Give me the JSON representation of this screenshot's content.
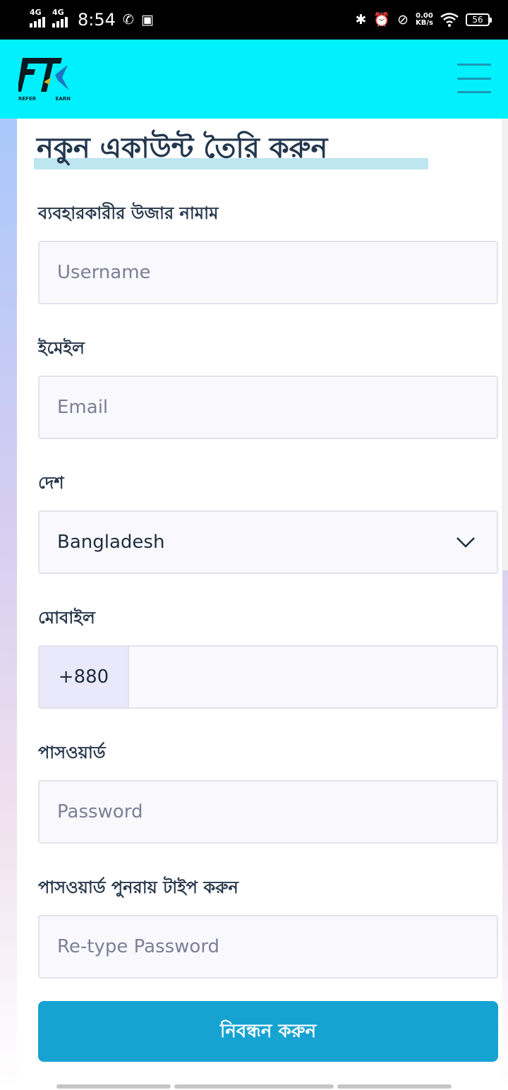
{
  "status_bar": {
    "network_1": "4G",
    "network_2": "4G",
    "time": "8:54",
    "icons": [
      "whatsapp-icon",
      "gallery-icon",
      "bluetooth-icon",
      "alarm-icon",
      "dnd-icon",
      "wifi-icon"
    ],
    "speed_value": "0.00",
    "speed_unit": "KB/s",
    "battery": "56"
  },
  "header": {
    "logo_letters": "FT",
    "logo_word_left": "REFER",
    "logo_word_right": "EARN",
    "brand_color": "#00f0fd"
  },
  "form": {
    "title": "নকুন একাউন্ট তৈরি করুন",
    "username_label": "ব্যবহারকারীর উজার নামাম",
    "username_placeholder": "Username",
    "email_label": "ইমেইল",
    "email_placeholder": "Email",
    "country_label": "দেশ",
    "country_value": "Bangladesh",
    "mobile_label": "মোবাইল",
    "mobile_prefix": "+880",
    "password_label": "পাসওয়ার্ড",
    "password_placeholder": "Password",
    "retype_label": "পাসওয়ার্ড পুনরায় টাইপ করুন",
    "retype_placeholder": "Re-type Password",
    "submit_label": "নিবন্ধন করুন",
    "submit_color": "#16a3d2"
  }
}
